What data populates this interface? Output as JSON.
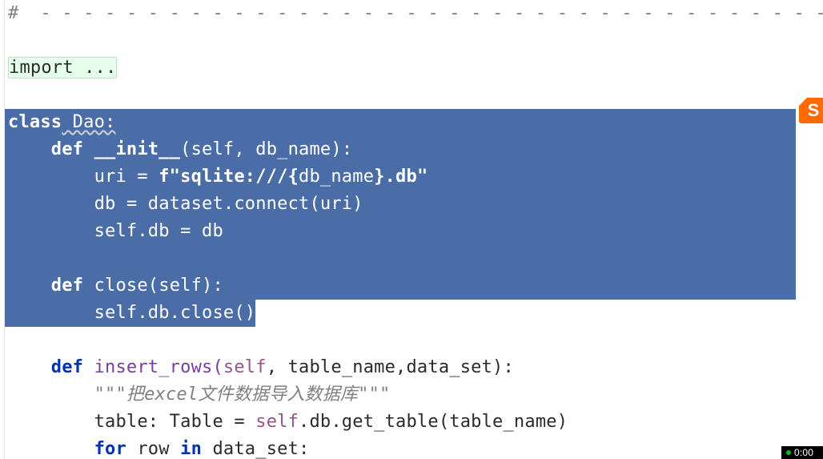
{
  "code": {
    "divider": "#  - - - - - - - - - - - - - - - - - - - - - - - - - - - - - - - - - - - - -",
    "import_fold": "import ...",
    "class_decl_kw": "class",
    "class_decl_name": " Dao:",
    "init_kw": "def",
    "init_name": "__init__",
    "init_params_open": "(",
    "init_self": "self",
    "init_rest": ", db_name):",
    "uri_lhs": "uri = ",
    "uri_f": "f\"sqlite:///",
    "uri_brace_open": "{",
    "uri_var": "db_name",
    "uri_brace_close": "}",
    "uri_end": ".db\"",
    "db_line": "db = dataset.connect(uri)",
    "selfdb_self": "self",
    "selfdb_rest": ".db = db",
    "close_kw": "def",
    "close_name": " close(",
    "close_self": "self",
    "close_rest": "):",
    "close_body_self": "self",
    "close_body_rest": ".db.close()",
    "insert_kw": "def",
    "insert_name": " insert_rows(",
    "insert_self": "self",
    "insert_rest": ", table_name,data_set):",
    "docstring": "\"\"\"把excel文件数据导入数据库\"\"\"",
    "table_line_a": "table: Table = ",
    "table_line_self": "self",
    "table_line_b": ".db.get_table(table_name)",
    "for_kw": "for",
    "for_mid": " row ",
    "in_kw": "in",
    "for_rest": " data_set:"
  },
  "ime_badge": "S",
  "clock": "0:00"
}
